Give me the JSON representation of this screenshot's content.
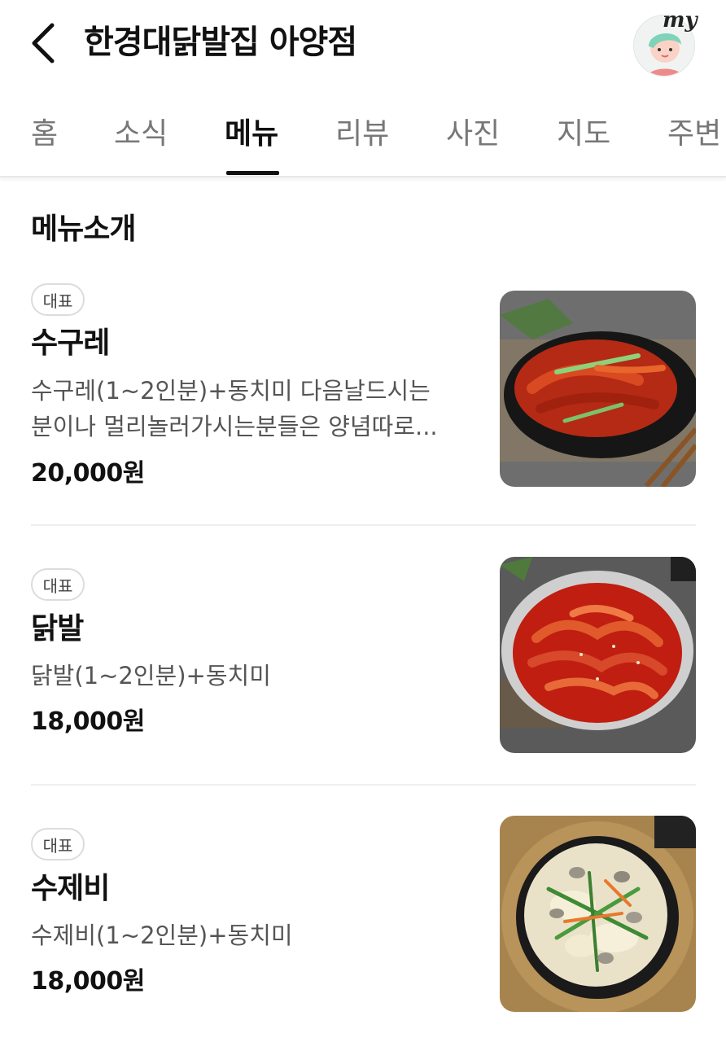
{
  "header": {
    "title": "한경대닭발집 아양점",
    "back_icon": "chevron-left-icon",
    "my_label": "my"
  },
  "tabs": [
    {
      "label": "홈",
      "active": false
    },
    {
      "label": "소식",
      "active": false
    },
    {
      "label": "메뉴",
      "active": true
    },
    {
      "label": "리뷰",
      "active": false
    },
    {
      "label": "사진",
      "active": false
    },
    {
      "label": "지도",
      "active": false
    },
    {
      "label": "주변",
      "active": false
    }
  ],
  "section": {
    "title": "메뉴소개"
  },
  "menu": [
    {
      "badge": "대표",
      "name": "수구레",
      "desc_line1": "수구레(1~2인분)+동치미 다음날드시는",
      "desc_line2": "분이나 멀리놀러가시는분들은 양념따로...",
      "price": "20,000원"
    },
    {
      "badge": "대표",
      "name": "닭발",
      "desc_line1": "닭발(1~2인분)+동치미",
      "price": "18,000원"
    },
    {
      "badge": "대표",
      "name": "수제비",
      "desc_line1": "수제비(1~2인분)+동치미",
      "price": "18,000원"
    }
  ],
  "colors": {
    "text_primary": "#111111",
    "text_secondary": "#555555",
    "tab_inactive": "#777777",
    "divider": "#efefef"
  }
}
